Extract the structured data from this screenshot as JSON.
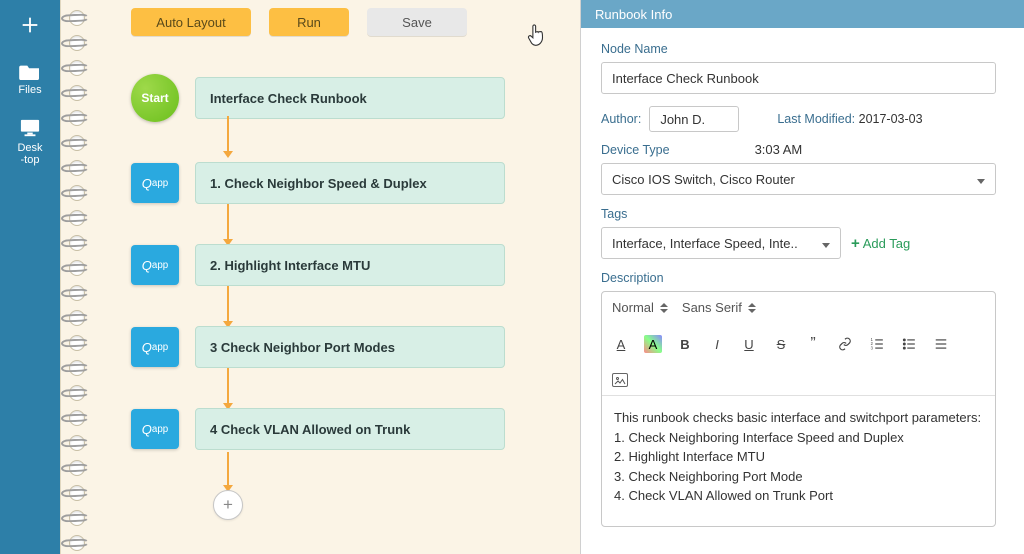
{
  "rail": {
    "items": [
      {
        "icon": "plus-icon",
        "label": ""
      },
      {
        "icon": "folder-icon",
        "label": "Files"
      },
      {
        "icon": "desktop-icon",
        "label": "Desk\n-top"
      }
    ]
  },
  "toolbar": {
    "auto_layout": "Auto Layout",
    "run": "Run",
    "save": "Save"
  },
  "flow": {
    "start_label": "Start",
    "qapp_label": "Qapp",
    "add_label": "+",
    "steps": [
      {
        "kind": "start",
        "title": "Interface Check Runbook"
      },
      {
        "kind": "qapp",
        "title": "1. Check Neighbor Speed & Duplex"
      },
      {
        "kind": "qapp",
        "title": "2. Highlight Interface MTU"
      },
      {
        "kind": "qapp",
        "title": "3 Check Neighbor Port Modes"
      },
      {
        "kind": "qapp",
        "title": "4 Check VLAN Allowed on Trunk"
      }
    ]
  },
  "panel": {
    "title": "Runbook Info",
    "node_name_label": "Node Name",
    "node_name_value": "Interface Check Runbook",
    "author_label": "Author:",
    "author_value": "John D.",
    "last_modified_label": "Last Modified:",
    "last_modified_date": "2017-03-03",
    "last_modified_time": "3:03 AM",
    "device_type_label": "Device Type",
    "device_type_value": "Cisco IOS Switch, Cisco Router",
    "tags_label": "Tags",
    "tags_value": "Interface, Interface Speed, Inte..",
    "add_tag_label": "Add Tag",
    "description_label": "Description",
    "editor": {
      "paragraph_style": "Normal",
      "font_family": "Sans Serif",
      "body_intro": "This runbook checks basic interface and switchport parameters:",
      "body_lines": [
        "1. Check Neighboring Interface Speed and Duplex",
        "2. Highlight Interface MTU",
        "3. Check Neighboring Port Mode",
        "4. Check VLAN Allowed on Trunk Port"
      ]
    }
  }
}
